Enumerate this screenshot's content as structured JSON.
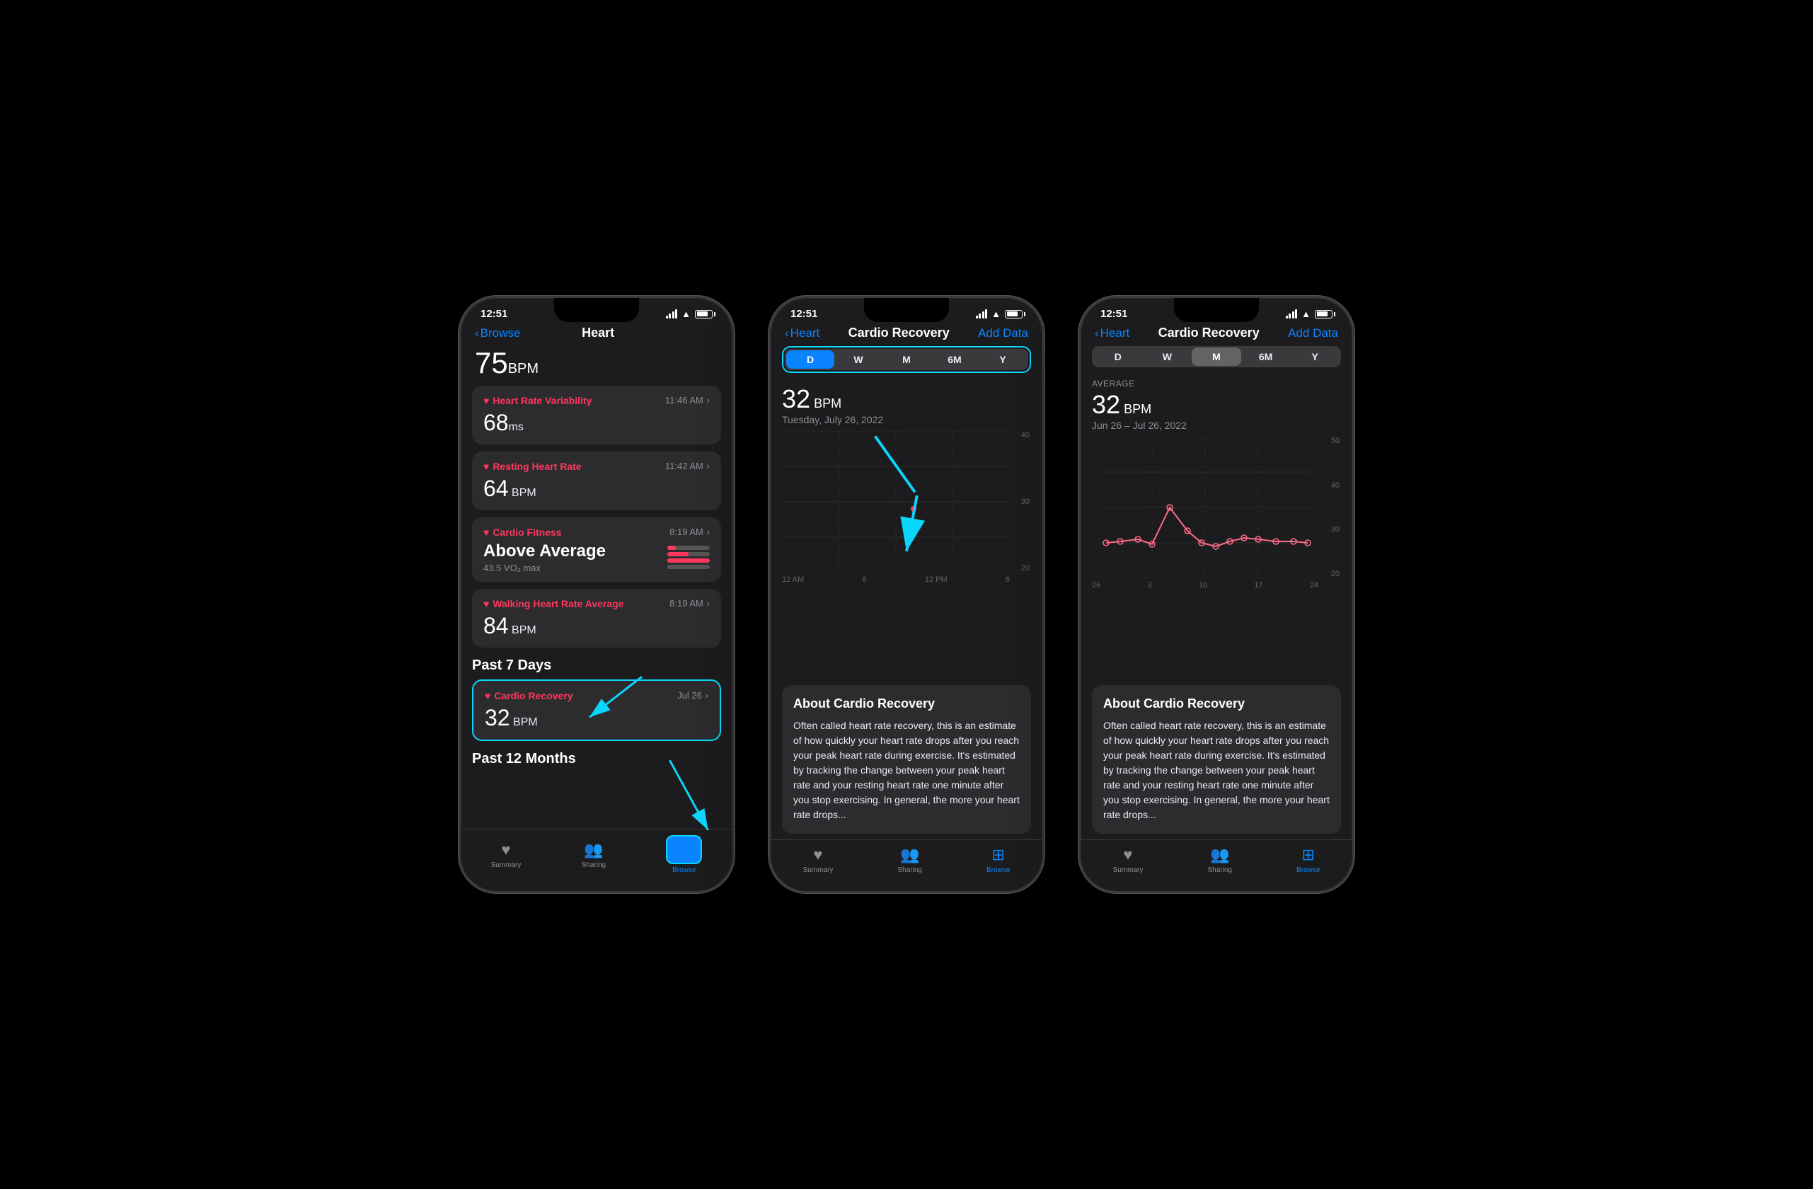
{
  "phone1": {
    "status": {
      "time": "12:51",
      "location": true
    },
    "nav": {
      "back_label": "Browse",
      "title": "Heart"
    },
    "bpm_top": "75",
    "bpm_unit": "BPM",
    "cards": [
      {
        "title": "Heart Rate Variability",
        "time": "11:46 AM",
        "value": "68",
        "unit": "ms",
        "sub": ""
      },
      {
        "title": "Resting Heart Rate",
        "time": "11:42 AM",
        "value": "64",
        "unit": "BPM",
        "sub": ""
      },
      {
        "title": "Cardio Fitness",
        "time": "8:19 AM",
        "value": "Above Average",
        "unit": "",
        "sub": "43.5 VO₂ max",
        "has_meter": true
      },
      {
        "title": "Walking Heart Rate Average",
        "time": "8:19 AM",
        "value": "84",
        "unit": "BPM",
        "sub": ""
      }
    ],
    "section_past7": "Past 7 Days",
    "cardio_recovery": {
      "title": "Cardio Recovery",
      "date": "Jul 26",
      "value": "32",
      "unit": "BPM"
    },
    "section_past12": "Past 12 Months",
    "tabs": [
      {
        "label": "Summary",
        "icon": "♥",
        "active": false
      },
      {
        "label": "Sharing",
        "icon": "👥",
        "active": false
      },
      {
        "label": "Browse",
        "icon": "⊞",
        "active": true
      }
    ]
  },
  "phone2": {
    "status": {
      "time": "12:51"
    },
    "nav": {
      "back_label": "Heart",
      "title": "Cardio Recovery",
      "action": "Add Data"
    },
    "time_buttons": [
      "D",
      "W",
      "M",
      "6M",
      "Y"
    ],
    "active_time": "D",
    "chart": {
      "value": "32",
      "unit": "BPM",
      "date": "Tuesday, July 26, 2022",
      "y_labels": [
        "40",
        "30",
        "20"
      ],
      "x_labels": [
        "12 AM",
        "6",
        "12 PM",
        "6"
      ]
    },
    "about": {
      "title": "About Cardio Recovery",
      "text": "Often called heart rate recovery, this is an estimate of how quickly your heart rate drops after you reach your peak heart rate during exercise. It's estimated by tracking the change between your peak heart rate and your resting heart rate one minute after you stop exercising. In general, the more your heart rate drops..."
    },
    "tabs": [
      {
        "label": "Summary",
        "icon": "♥",
        "active": false
      },
      {
        "label": "Sharing",
        "icon": "👥",
        "active": false
      },
      {
        "label": "Browse",
        "icon": "⊞",
        "active": true
      }
    ]
  },
  "phone3": {
    "status": {
      "time": "12:51"
    },
    "nav": {
      "back_label": "Heart",
      "title": "Cardio Recovery",
      "action": "Add Data"
    },
    "time_buttons": [
      "D",
      "W",
      "M",
      "6M",
      "Y"
    ],
    "active_time": "M",
    "avg_label": "AVERAGE",
    "chart": {
      "value": "32",
      "unit": "BPM",
      "date": "Jun 26 – Jul 26, 2022",
      "y_labels": [
        "50",
        "40",
        "30",
        "20"
      ],
      "x_labels": [
        "26",
        "3",
        "10",
        "17",
        "24"
      ]
    },
    "about": {
      "title": "About Cardio Recovery",
      "text": "Often called heart rate recovery, this is an estimate of how quickly your heart rate drops after you reach your peak heart rate during exercise. It's estimated by tracking the change between your peak heart rate and your resting heart rate one minute after you stop exercising. In general, the more your heart rate drops..."
    },
    "tabs": [
      {
        "label": "Summary",
        "icon": "♥",
        "active": false
      },
      {
        "label": "Sharing",
        "icon": "👥",
        "active": false
      },
      {
        "label": "Browse",
        "icon": "⊞",
        "active": true
      }
    ]
  }
}
